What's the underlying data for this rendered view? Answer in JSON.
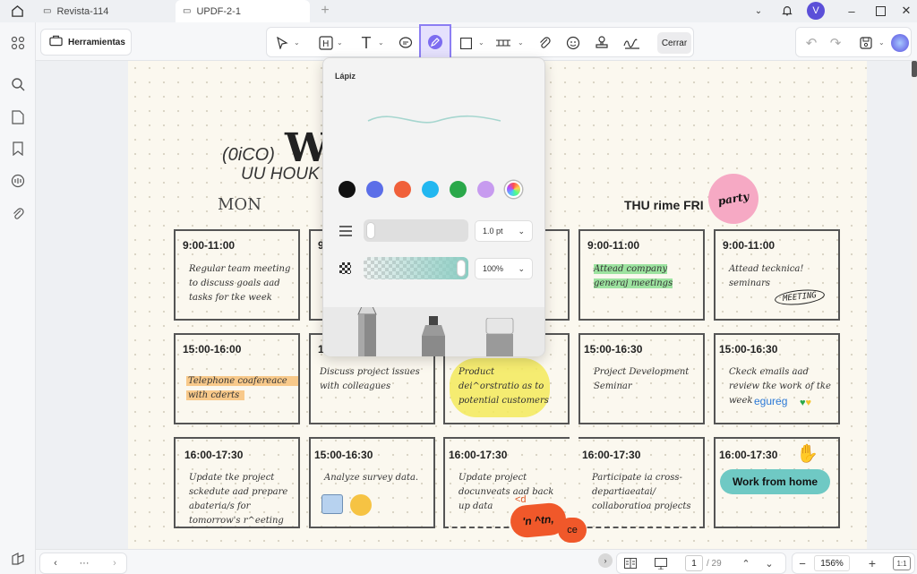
{
  "tabs": [
    {
      "label": "Revista-114",
      "active": false
    },
    {
      "label": "UPDF-2-1",
      "active": true
    }
  ],
  "toolbar": {
    "tools_label": "Herramientas",
    "close_label": "Cerrar"
  },
  "user": {
    "avatar_initial": "V"
  },
  "popup": {
    "title": "Lápiz",
    "colors": [
      "#111111",
      "#5b6ee8",
      "#f0603a",
      "#22b7f0",
      "#2aa84a",
      "#c79bef"
    ],
    "stroke_width": "1.0 pt",
    "opacity": "100%",
    "tools": [
      "pencil-tool",
      "highlighter-tool",
      "eraser-tool"
    ]
  },
  "doc": {
    "header_left": "(0iCO)",
    "header_big": "W",
    "header_sub": "UU HOUK",
    "day_mon": "MON",
    "day_thu": "THU rime FRI",
    "sticker_party": "party",
    "stamp_meeting": "MEETING",
    "sticker_work": "Work from home",
    "row1": [
      {
        "time": "9:00-11:00",
        "lines": [
          "Regular team meeting",
          "to discuss goals aad",
          "tasks for tke week"
        ]
      },
      {
        "time": "9",
        "lines": []
      },
      {
        "time": "",
        "lines": []
      },
      {
        "time": "9:00-11:00",
        "lines": [
          "Attead company",
          "generaj meetings"
        ]
      },
      {
        "time": "9:00-11:00",
        "lines": [
          "Attead tecknica!",
          "seminars"
        ]
      }
    ],
    "row2": [
      {
        "time": "15:00-16:00",
        "lines": [
          "Telephone coafereace",
          "with cderts"
        ]
      },
      {
        "time": "1",
        "lines": [
          "Discuss project issues",
          "with colleagues"
        ]
      },
      {
        "time": "",
        "lines": [
          "Product",
          "dei^orstratio as to",
          "potential customers"
        ]
      },
      {
        "time": "15:00-16:30",
        "lines": [
          "Project Development",
          "Seminar"
        ]
      },
      {
        "time": "15:00-16:30",
        "lines": [
          "Ckeck emails aad",
          "review tke work of tke",
          "week"
        ]
      }
    ],
    "row2_extra": "egureg",
    "row3": [
      {
        "time": "16:00-17:30",
        "lines": [
          "Update tke project",
          "sckedute aad prepare",
          "abateria/s for",
          "tomorrow's r^eeting"
        ]
      },
      {
        "time": "15:00-16:30",
        "lines": [
          "Analyze survey data."
        ]
      },
      {
        "time": "16:00-17:30",
        "lines": [
          "Update project",
          "docunveats aad back",
          "up data"
        ]
      },
      {
        "time": "16:00-17:30",
        "lines": [
          "Participate ia cross-",
          "departiaeatai/",
          "collaboratioa projects"
        ]
      },
      {
        "time": "16:00-17:30",
        "lines": []
      }
    ],
    "sticker_red_top": "<d",
    "sticker_red_1": "'n ^tn,",
    "sticker_red_2": "ce"
  },
  "bottom": {
    "page_current": "1",
    "page_total": "/ 29",
    "zoom": "156%",
    "more": "···"
  },
  "accent": "#7c6cf0"
}
